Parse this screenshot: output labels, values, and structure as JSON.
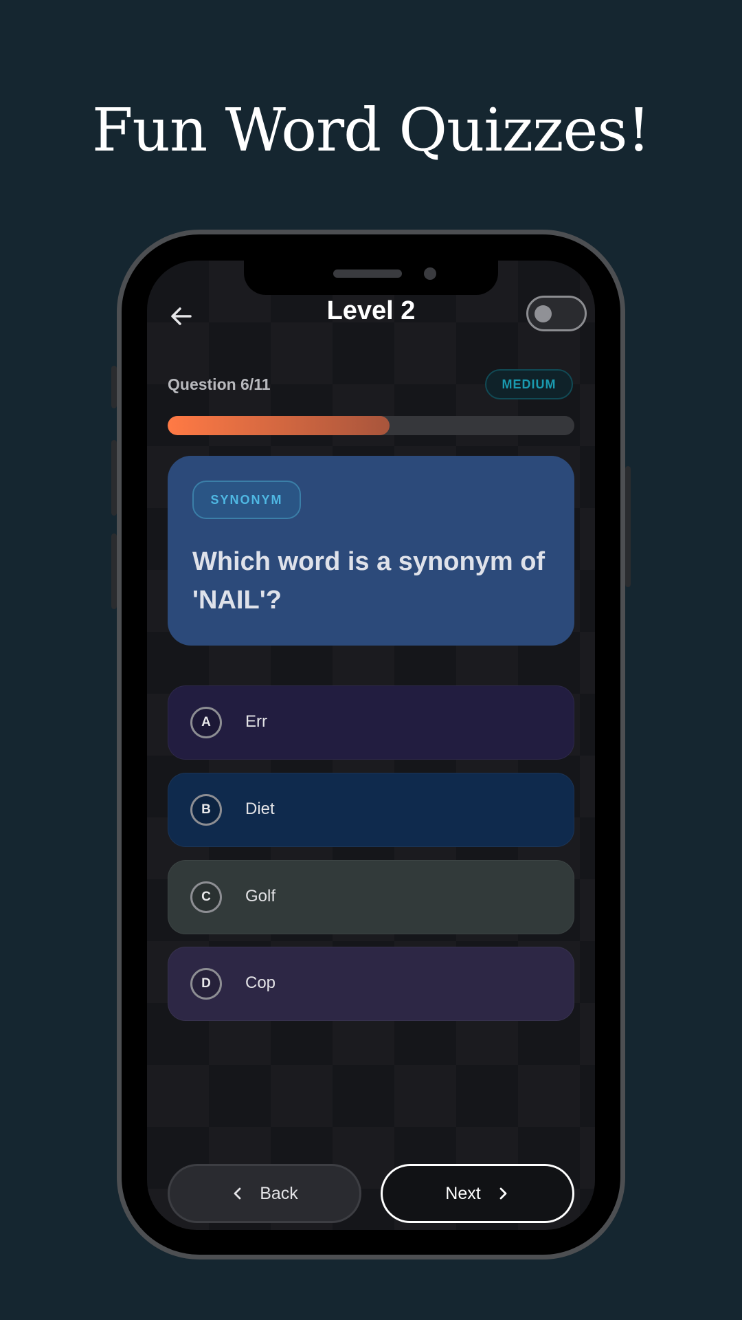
{
  "headline": "Fun Word Quizzes!",
  "header": {
    "title": "Level 2",
    "back_icon": "arrow-left-icon",
    "theme_toggle_on": false
  },
  "quiz": {
    "counter": "Question 6/11",
    "difficulty": "MEDIUM",
    "progress_fraction": 0.545
  },
  "question": {
    "type": "SYNONYM",
    "text": "Which word is a synonym of 'NAIL'?"
  },
  "options": [
    {
      "letter": "A",
      "label": "Err",
      "color": "#221d40"
    },
    {
      "letter": "B",
      "label": "Diet",
      "color": "#0f2a4d"
    },
    {
      "letter": "C",
      "label": "Golf",
      "color": "#323a3a"
    },
    {
      "letter": "D",
      "label": "Cop",
      "color": "#2d2745"
    }
  ],
  "nav": {
    "back_label": "Back",
    "next_label": "Next"
  },
  "colors": {
    "background": "#152630",
    "question_card": "#2c4a7a",
    "progress_start": "#ff7a45",
    "difficulty_text": "#1a9bb0"
  }
}
